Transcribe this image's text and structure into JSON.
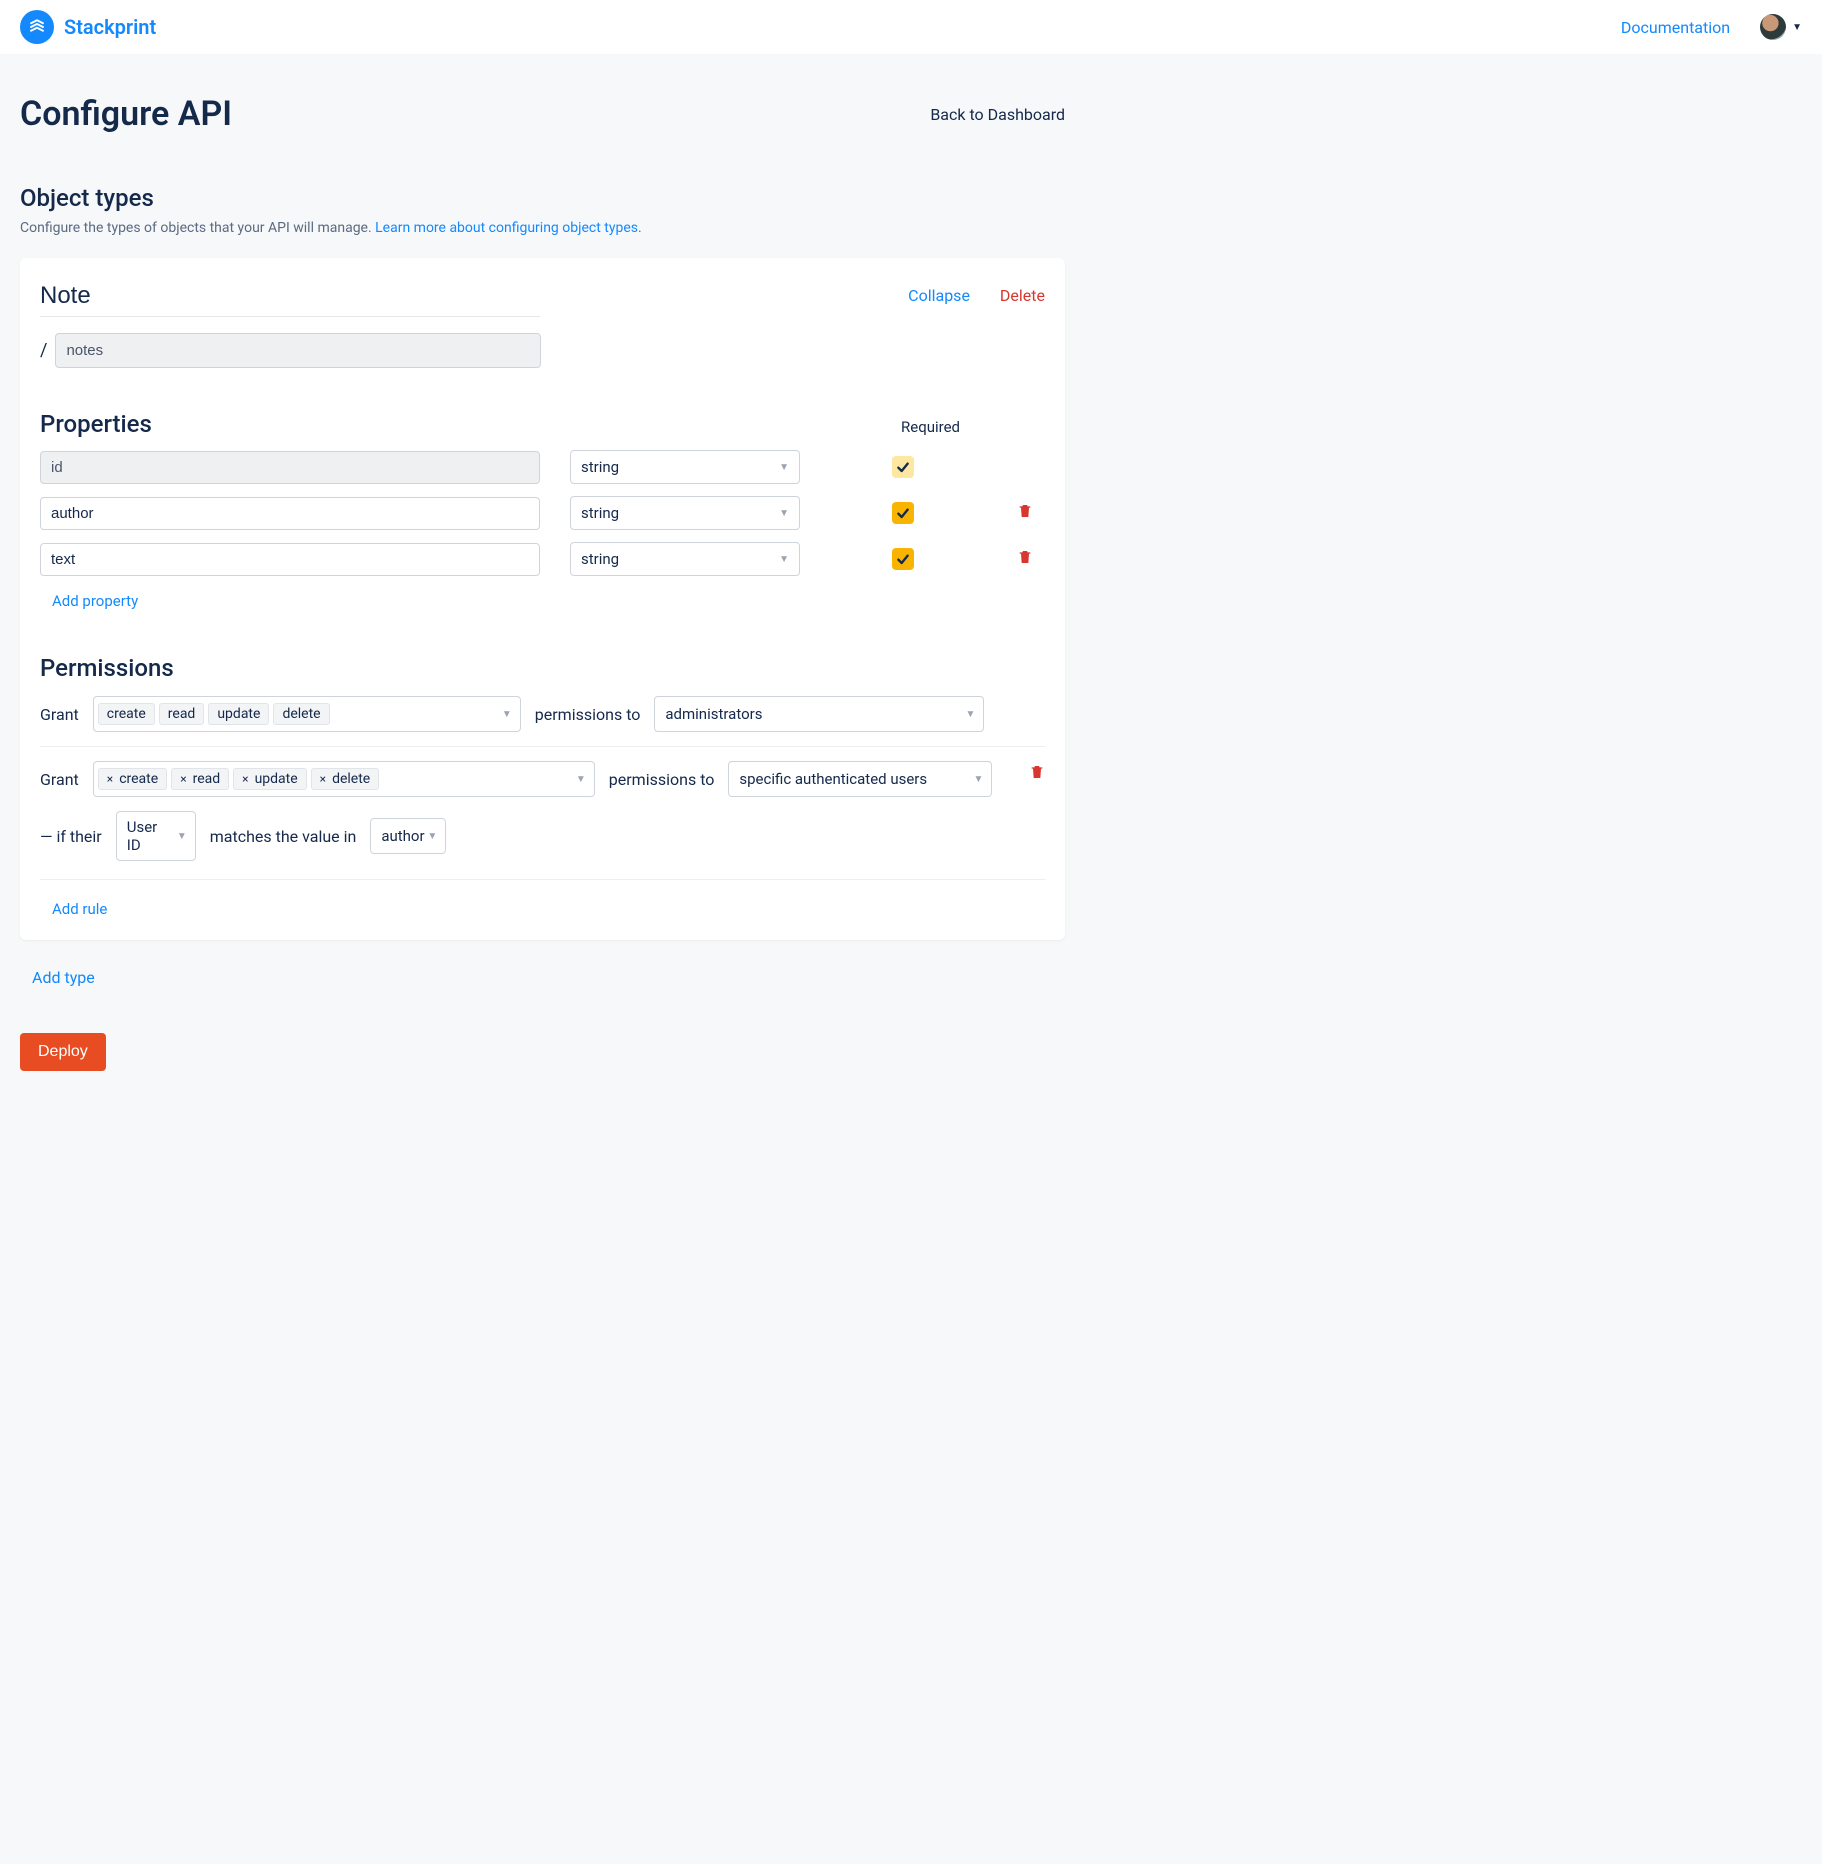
{
  "header": {
    "brand": "Stackprint",
    "doc_link": "Documentation"
  },
  "page": {
    "title": "Configure API",
    "back": "Back to Dashboard"
  },
  "object_types": {
    "title": "Object types",
    "desc": "Configure the types of objects that your API will manage. ",
    "learn_more": "Learn more about configuring object types",
    "period": "."
  },
  "type": {
    "name": "Note",
    "collapse": "Collapse",
    "delete": "Delete",
    "slash": "/",
    "path": "notes",
    "properties_title": "Properties",
    "required_label": "Required",
    "props": [
      {
        "name": "id",
        "type": "string",
        "readonly": true
      },
      {
        "name": "author",
        "type": "string",
        "readonly": false
      },
      {
        "name": "text",
        "type": "string",
        "readonly": false
      }
    ],
    "add_property": "Add property",
    "permissions_title": "Permissions",
    "perm1": {
      "grant": "Grant",
      "ops": [
        "create",
        "read",
        "update",
        "delete"
      ],
      "perms_to": "permissions to",
      "target": "administrators"
    },
    "perm2": {
      "grant": "Grant",
      "ops": [
        "create",
        "read",
        "update",
        "delete"
      ],
      "perms_to": "permissions to",
      "target": "specific authenticated users",
      "if_label": "— if their",
      "claim": "User ID",
      "matches": "matches the value in",
      "field": "author"
    },
    "add_rule": "Add rule"
  },
  "add_type": "Add type",
  "deploy": "Deploy"
}
